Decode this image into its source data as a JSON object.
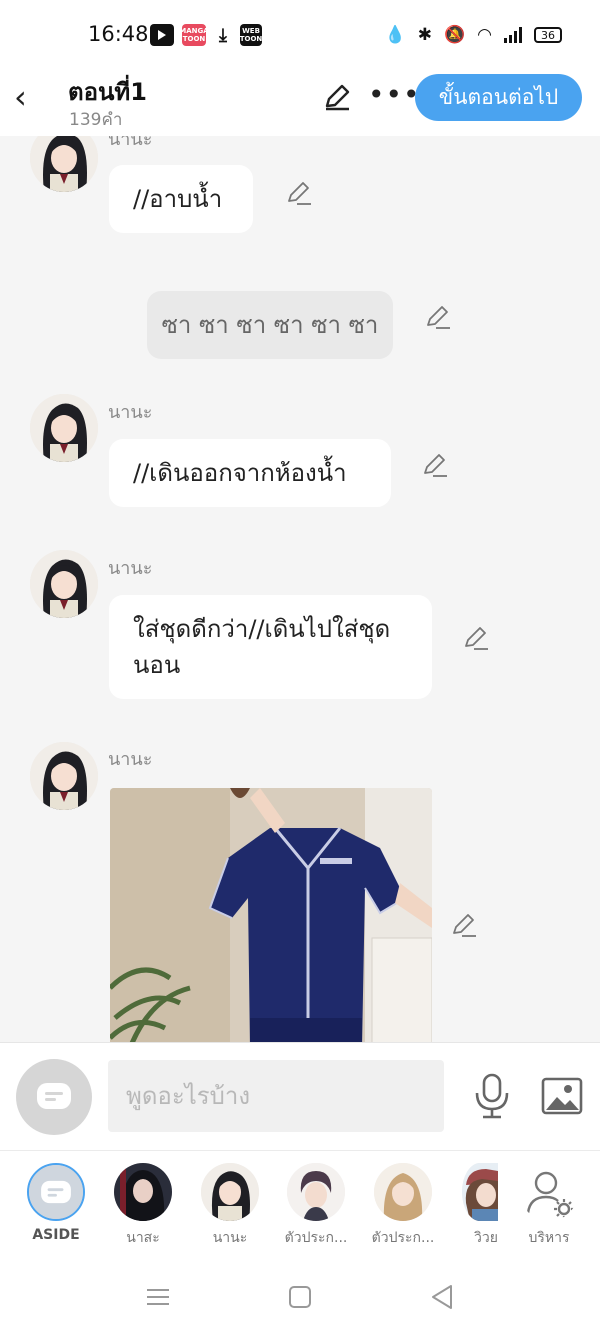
{
  "status_bar": {
    "time": "16:48",
    "apps": [
      "youtube-icon",
      "mangatoon-icon",
      "download-icon",
      "webtoon-icon"
    ],
    "manga_label": "MANGA TOON",
    "webtoon_label": "WEB TOON",
    "battery": "36"
  },
  "header": {
    "title": "ตอนที่1",
    "word_count": "139คำ",
    "next_button": "ขั้นตอนต่อไป",
    "more": "•••"
  },
  "messages": [
    {
      "type": "character",
      "speaker": "นานะ",
      "text": "//อาบน้ำ"
    },
    {
      "type": "narration",
      "text": "ซา ซา ซา ซา ซา ซา"
    },
    {
      "type": "character",
      "speaker": "นานะ",
      "text": "//เดินออกจากห้องน้ำ"
    },
    {
      "type": "character",
      "speaker": "นานะ",
      "text": "ใส่ชุดดีกว่า//เดินไปใส่ชุดนอน"
    },
    {
      "type": "image",
      "speaker": "นานะ",
      "image": "navy-pajamas-photo"
    }
  ],
  "input": {
    "placeholder": "พูดอะไรบ้าง",
    "value": ""
  },
  "characters": [
    {
      "label": "ASIDE"
    },
    {
      "label": "นาสะ"
    },
    {
      "label": "นานะ"
    },
    {
      "label": "ตัวประก..."
    },
    {
      "label": "ตัวประก..."
    },
    {
      "label": "วิวย"
    },
    {
      "label": "บริหาร"
    }
  ],
  "colors": {
    "accent": "#4aa3f0",
    "background": "#f5f5f5",
    "bubble": "#ffffff",
    "narration_bubble": "#e9e9e9"
  }
}
